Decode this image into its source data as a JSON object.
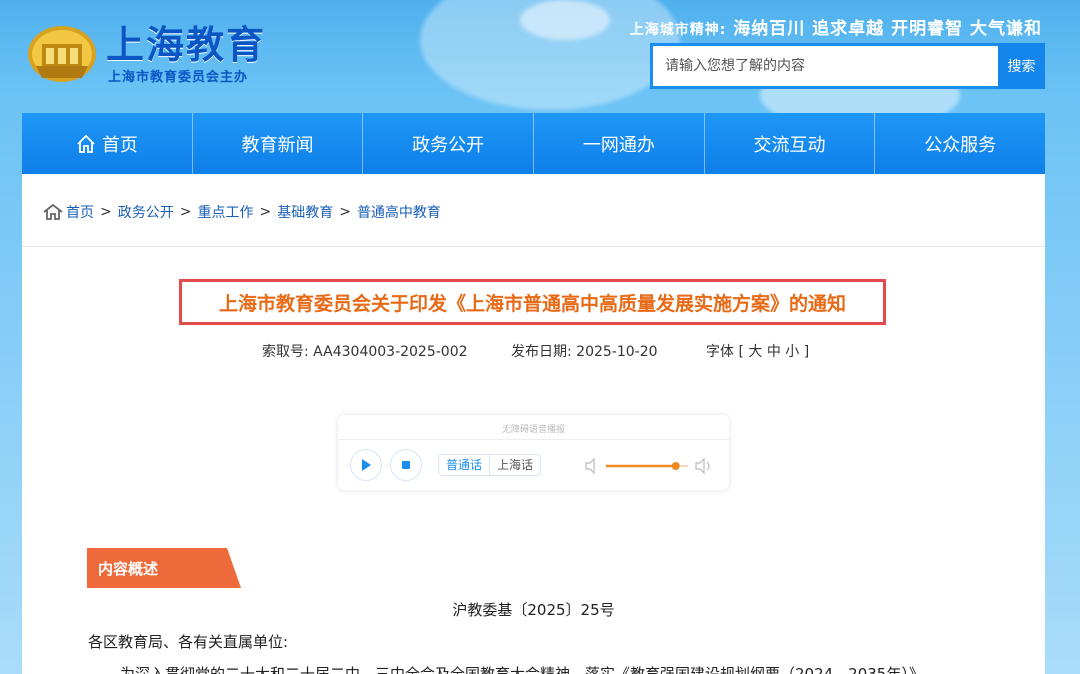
{
  "header": {
    "site_title": "上海教育",
    "site_subtitle": "上海市教育委员会主办",
    "slogan_label": "上海城市精神:",
    "slogan_text": "海纳百川 追求卓越 开明睿智 大气谦和",
    "search_placeholder": "请输入您想了解的内容",
    "search_button": "搜索"
  },
  "nav": {
    "items": [
      {
        "label": "首页",
        "icon": "home-icon"
      },
      {
        "label": "教育新闻"
      },
      {
        "label": "政务公开"
      },
      {
        "label": "一网通办"
      },
      {
        "label": "交流互动"
      },
      {
        "label": "公众服务"
      }
    ]
  },
  "breadcrumb": {
    "items": [
      "首页",
      "政务公开",
      "重点工作",
      "基础教育",
      "普通高中教育"
    ],
    "separator": ">"
  },
  "article": {
    "title": "上海市教育委员会关于印发《上海市普通高中高质量发展实施方案》的通知",
    "index_label": "索取号:",
    "index_value": "AA4304003-2025-002",
    "date_label": "发布日期:",
    "date_value": "2025-10-20",
    "font_label": "字体 [",
    "font_large": "大",
    "font_medium": "中",
    "font_small": "小",
    "font_end": "]",
    "doc_number": "沪教委基〔2025〕25号",
    "salutation": "各区教育局、各有关直属单位:",
    "paragraph_start": "为深入贯彻党的二十大和二十届二中、三中全会及全国教育大会精神，落实《教育强国建设规划纲要（2024—2035年）》"
  },
  "player": {
    "title": "无障碍语音播报",
    "lang_options": [
      "普通话",
      "上海话"
    ],
    "selected_lang": "普通话",
    "volume_fraction": 0.85
  },
  "section": {
    "label": "内容概述"
  },
  "colors": {
    "nav_blue": "#1585ee",
    "title_orange": "#e86a16",
    "title_border": "#e24b4b",
    "tag_orange": "#ef6a3a",
    "link_blue": "#1a5fb8"
  }
}
